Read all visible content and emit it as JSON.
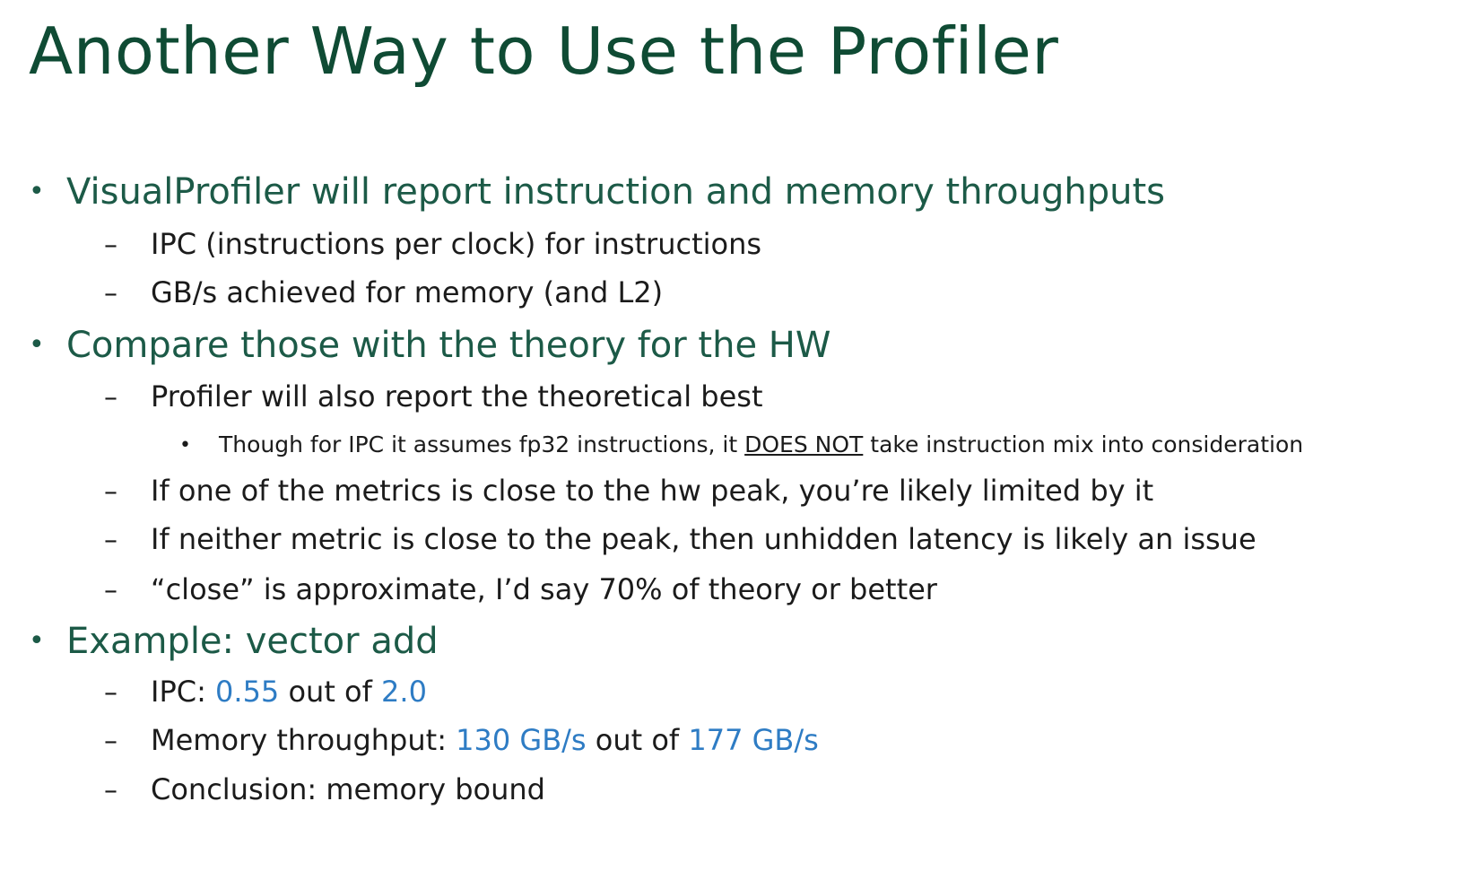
{
  "title": "Another Way to Use the Profiler",
  "items": [
    {
      "level": 1,
      "text": "VisualProfiler will report instruction and memory throughputs"
    },
    {
      "level": 2,
      "text": "IPC (instructions per clock) for instructions"
    },
    {
      "level": 2,
      "text": "GB/s achieved for memory (and L2)"
    },
    {
      "level": 1,
      "text": "Compare those with the theory for the HW"
    },
    {
      "level": 2,
      "text": "Profiler will also report the theoretical best"
    },
    {
      "level": 3,
      "parts": [
        "Though for IPC it assumes fp32 instructions, it ",
        "DOES NOT",
        " take instruction mix into consideration"
      ]
    },
    {
      "level": 2,
      "text": "If one of the metrics is close to the hw peak, you’re likely limited by it"
    },
    {
      "level": 2,
      "text": "If neither metric is close to the peak, then unhidden latency is likely an issue"
    },
    {
      "level": 2,
      "text": "“close” is approximate, I’d say 70% of theory or better"
    },
    {
      "level": 1,
      "text": "Example: vector add"
    },
    {
      "level": 2,
      "parts": [
        "IPC: ",
        "0.55",
        " out of ",
        "2.0"
      ]
    },
    {
      "level": 2,
      "parts": [
        "Memory throughput: ",
        "130 GB/s",
        " out of ",
        "177 GB/s"
      ]
    },
    {
      "level": 2,
      "text": "Conclusion: memory bound"
    }
  ],
  "bullet_glyphs": {
    "level1": "•",
    "level2": "–",
    "level3": "•"
  },
  "colors": {
    "title": "#0f4b34",
    "level1": "#1c5a47",
    "body": "#1b1b1b",
    "highlight": "#2e7cc4"
  }
}
